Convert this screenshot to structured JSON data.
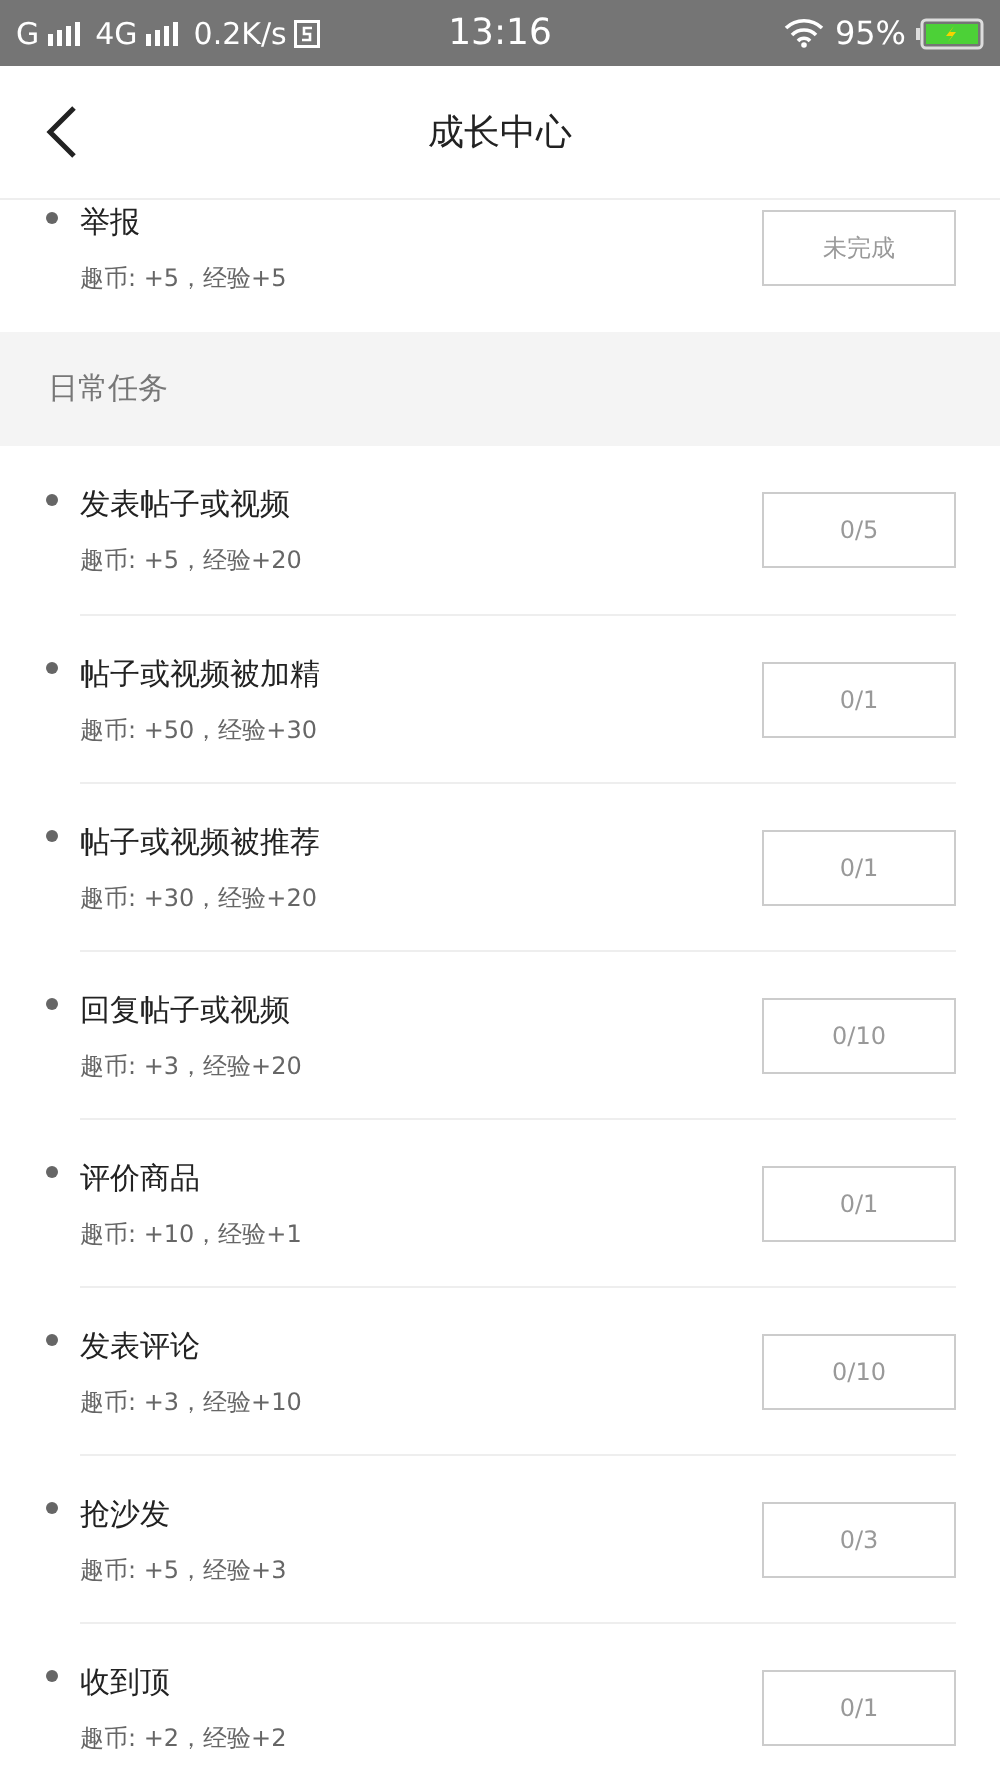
{
  "status_bar": {
    "carrier": "G",
    "network": "4G",
    "speed": "0.2K/s",
    "time": "13:16",
    "battery": "95%"
  },
  "header": {
    "title": "成长中心"
  },
  "sections": [
    {
      "tasks": [
        {
          "title": "举报",
          "reward": "趣币: +5，经验+5",
          "status": "未完成"
        }
      ]
    },
    {
      "title": "日常任务",
      "tasks": [
        {
          "title": "发表帖子或视频",
          "reward": "趣币: +5，经验+20",
          "status": "0/5"
        },
        {
          "title": "帖子或视频被加精",
          "reward": "趣币: +50，经验+30",
          "status": "0/1"
        },
        {
          "title": "帖子或视频被推荐",
          "reward": "趣币: +30，经验+20",
          "status": "0/1"
        },
        {
          "title": "回复帖子或视频",
          "reward": "趣币: +3，经验+20",
          "status": "0/10"
        },
        {
          "title": "评价商品",
          "reward": "趣币: +10，经验+1",
          "status": "0/1"
        },
        {
          "title": "发表评论",
          "reward": "趣币: +3，经验+10",
          "status": "0/10"
        },
        {
          "title": "抢沙发",
          "reward": "趣币: +5，经验+3",
          "status": "0/3"
        },
        {
          "title": "收到顶",
          "reward": "趣币: +2，经验+2",
          "status": "0/1"
        }
      ]
    }
  ]
}
